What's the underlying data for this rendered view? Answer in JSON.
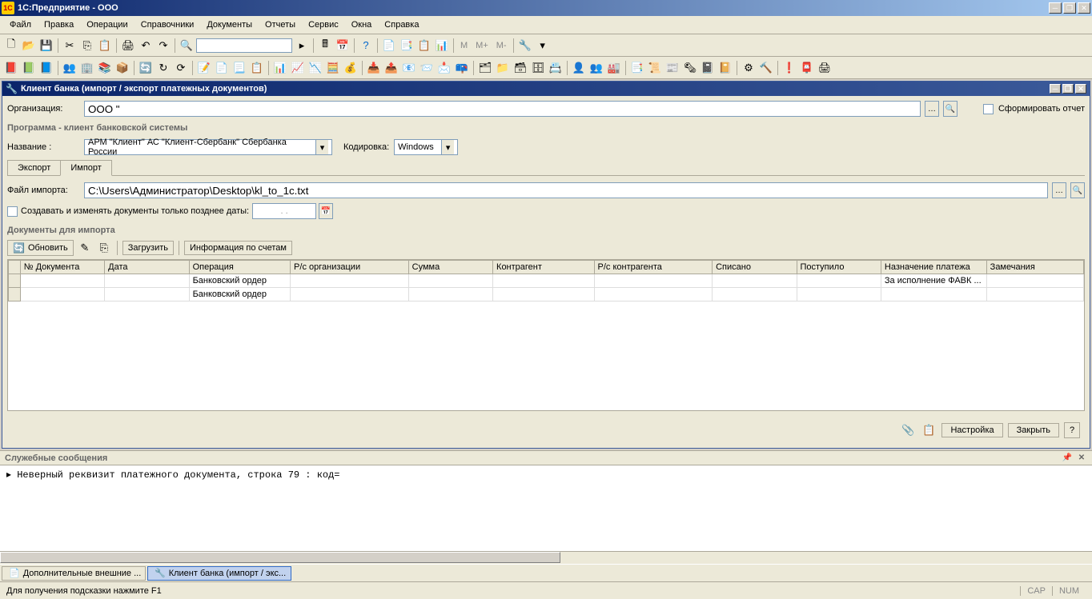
{
  "app": {
    "title": "1С:Предприятие - ООО",
    "logo": "1C"
  },
  "menu": {
    "file": "Файл",
    "edit": "Правка",
    "operations": "Операции",
    "references": "Справочники",
    "documents": "Документы",
    "reports": "Отчеты",
    "service": "Сервис",
    "windows": "Окна",
    "help": "Справка"
  },
  "toolbar_m": {
    "m": "М",
    "mplus": "М+",
    "mminus": "М-"
  },
  "subwindow": {
    "title": "Клиент банка (импорт / экспорт платежных документов)"
  },
  "form": {
    "org_label": "Организация:",
    "org_value": "ООО \"",
    "report_checkbox": "Сформировать отчет",
    "section1": "Программа - клиент банковской системы",
    "name_label": "Название :",
    "name_value": "АРМ \"Клиент\" АС \"Клиент-Сбербанк\" Сбербанка России",
    "encoding_label": "Кодировка:",
    "encoding_value": "Windows",
    "tabs": {
      "export": "Экспорт",
      "import": "Импорт"
    },
    "file_label": "Файл импорта:",
    "file_value": "C:\\Users\\Администратор\\Desktop\\kl_to_1c.txt",
    "create_checkbox": "Создавать и изменять документы только позднее даты:",
    "date_placeholder": ". .",
    "section2": "Документы для импорта",
    "actions": {
      "refresh": "Обновить",
      "load": "Загрузить",
      "info": "Информация по счетам"
    }
  },
  "table": {
    "headers": [
      "№ Документа",
      "Дата",
      "Операция",
      "Р/с организации",
      "Сумма",
      "Контрагент",
      "Р/с контрагента",
      "Списано",
      "Поступило",
      "Назначение платежа",
      "Замечания"
    ],
    "rows": [
      {
        "operation": "Банковский ордер",
        "purpose": "За исполнение ФАВК ..."
      },
      {
        "operation": "Банковский ордер",
        "purpose": ""
      }
    ]
  },
  "bottom": {
    "settings": "Настройка",
    "close": "Закрыть"
  },
  "messages": {
    "title": "Служебные сообщения",
    "line1": "Неверный реквизит платежного документа, строка 79 : код="
  },
  "taskbar": {
    "task1": "Дополнительные внешние ...",
    "task2": "Клиент банка (импорт / экс..."
  },
  "status": {
    "hint": "Для получения подсказки нажмите F1",
    "cap": "CAP",
    "num": "NUM"
  }
}
